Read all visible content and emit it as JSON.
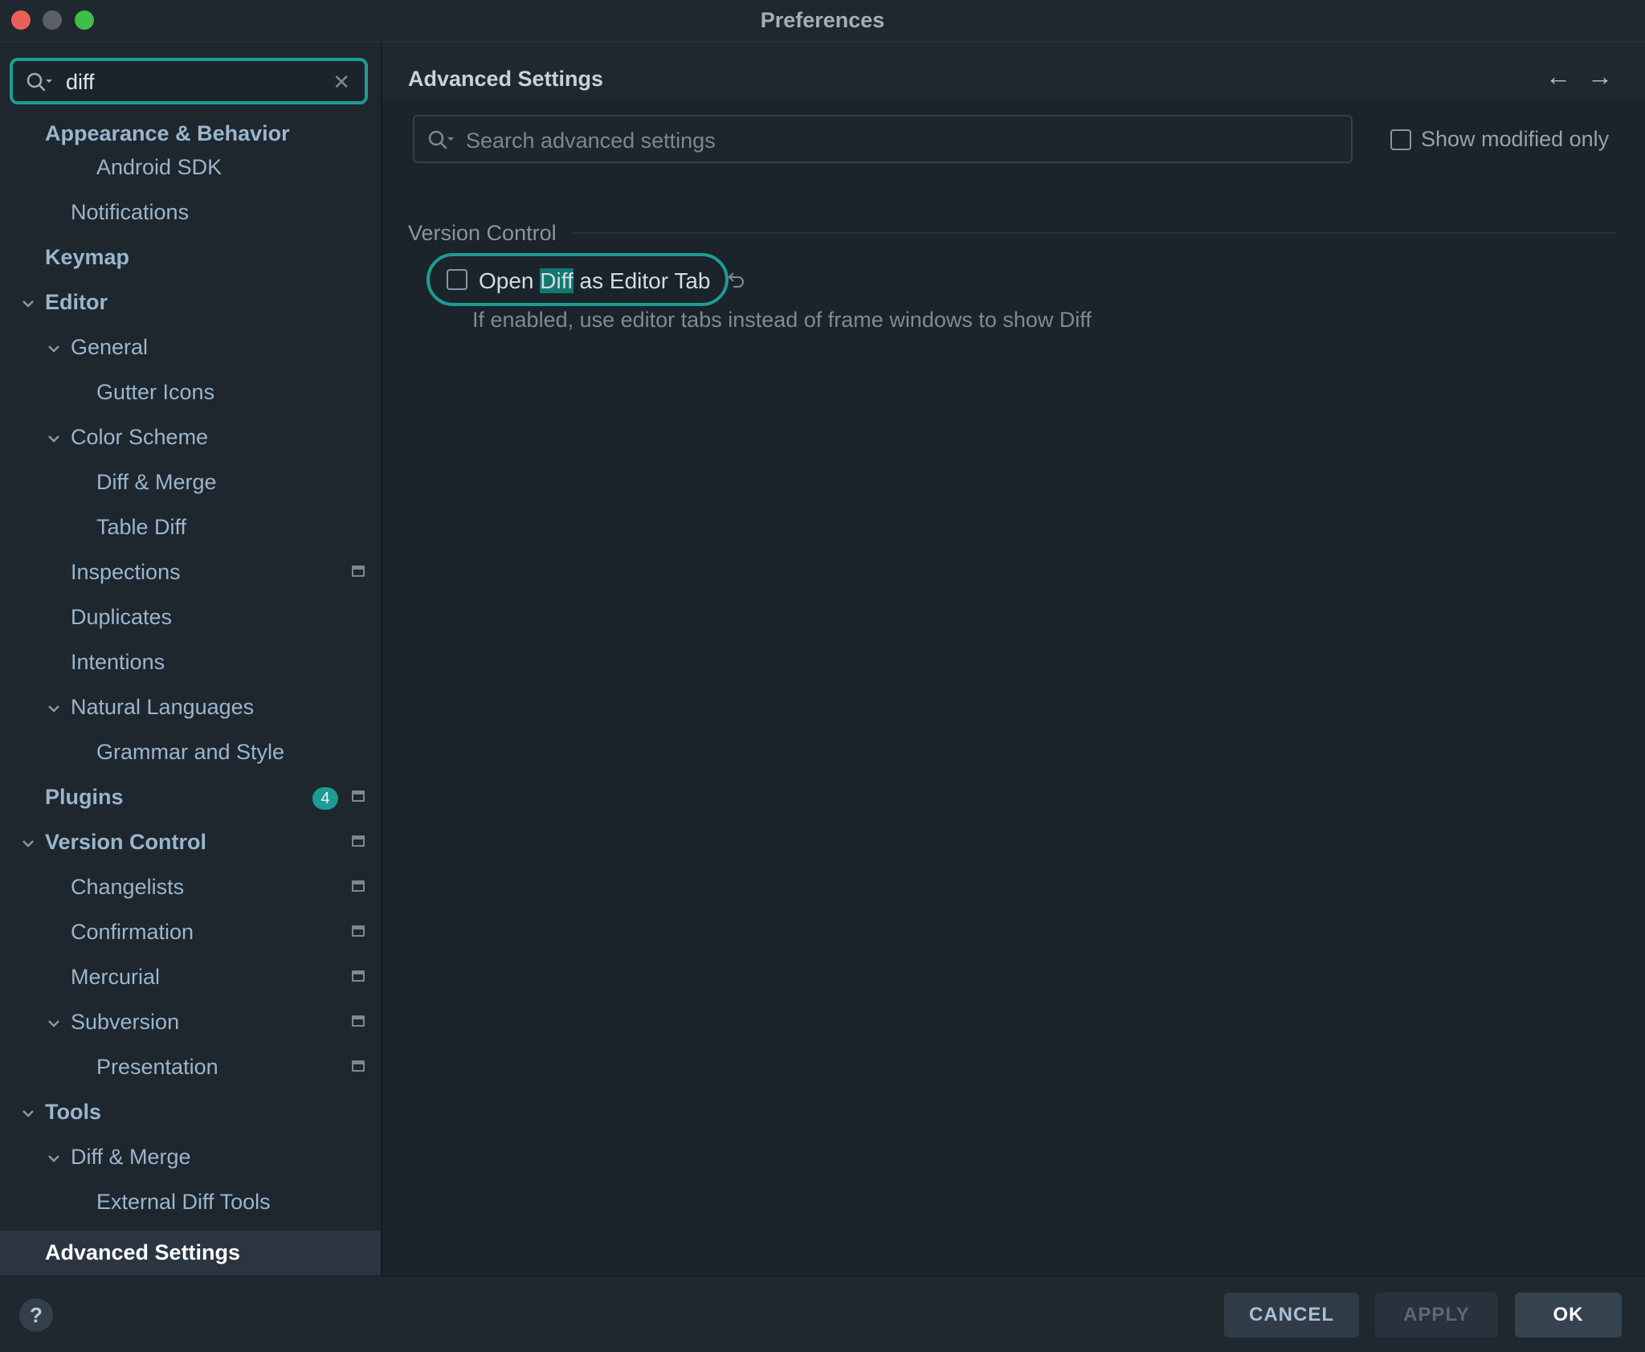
{
  "window": {
    "title": "Preferences"
  },
  "sidebar": {
    "search_value": "diff",
    "items": [
      {
        "label": "Appearance & Behavior",
        "bold": true
      },
      {
        "label": "Android SDK"
      },
      {
        "label": "Notifications"
      },
      {
        "label": "Keymap",
        "bold": true
      },
      {
        "label": "Editor",
        "bold": true
      },
      {
        "label": "General"
      },
      {
        "label": "Gutter Icons"
      },
      {
        "label": "Color Scheme"
      },
      {
        "label": "Diff & Merge"
      },
      {
        "label": "Table Diff"
      },
      {
        "label": "Inspections"
      },
      {
        "label": "Duplicates"
      },
      {
        "label": "Intentions"
      },
      {
        "label": "Natural Languages"
      },
      {
        "label": "Grammar and Style"
      },
      {
        "label": "Plugins",
        "bold": true,
        "badge": "4"
      },
      {
        "label": "Version Control",
        "bold": true
      },
      {
        "label": "Changelists"
      },
      {
        "label": "Confirmation"
      },
      {
        "label": "Mercurial"
      },
      {
        "label": "Subversion"
      },
      {
        "label": "Presentation"
      },
      {
        "label": "Tools",
        "bold": true
      },
      {
        "label": "Diff & Merge"
      },
      {
        "label": "External Diff Tools"
      },
      {
        "label": "Advanced Settings",
        "bold": true,
        "selected": true
      }
    ]
  },
  "main": {
    "title": "Advanced Settings",
    "search_placeholder": "Search advanced settings",
    "show_modified_label": "Show modified only",
    "show_modified_checked": false,
    "section": "Version Control",
    "setting": {
      "label_before": "Open ",
      "label_highlight": "Diff",
      "label_after": " as Editor Tab",
      "checked": false,
      "description": "If enabled, use editor tabs instead of frame windows to show Diff"
    }
  },
  "footer": {
    "help_label": "?",
    "cancel_label": "CANCEL",
    "apply_label": "APPLY",
    "ok_label": "OK"
  },
  "colors": {
    "accent": "#1d9c94",
    "background": "#1b232b",
    "sidebar_bg": "#1e262e",
    "link_text": "#9ab6cc"
  },
  "icons": {
    "search": "search-icon",
    "clear": "clear-icon",
    "chevron": "chevron-down-icon",
    "project_scope": "project-scope-icon",
    "back": "back-arrow-icon",
    "forward": "forward-arrow-icon",
    "reset": "reset-icon"
  }
}
